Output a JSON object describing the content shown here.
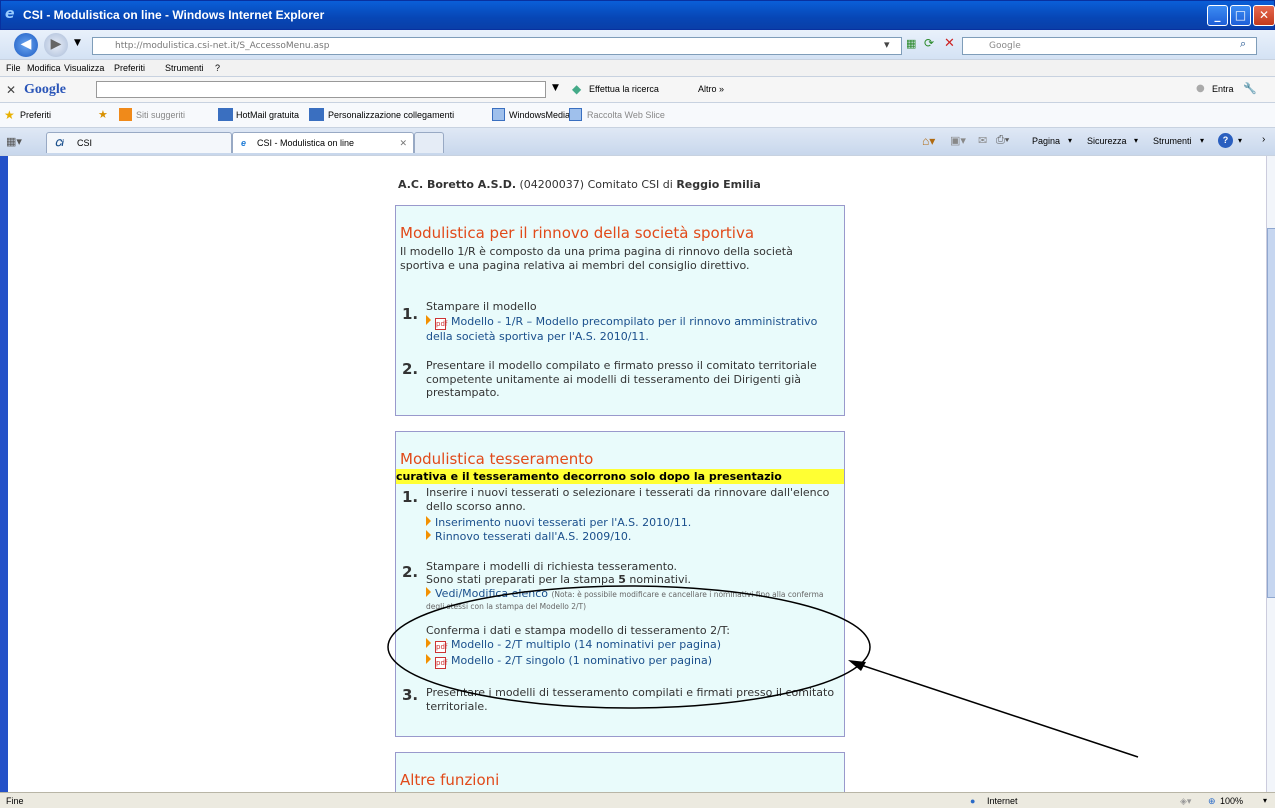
{
  "window": {
    "title": "CSI - Modulistica on line - Windows Internet Explorer"
  },
  "address": {
    "url": "http://modulistica.csi-net.it/S_AccessoMenu.asp",
    "search_placeholder": "Google"
  },
  "menu": [
    "File",
    "Modifica",
    "Visualizza",
    "Preferiti",
    "Strumenti",
    "?"
  ],
  "google_bar": {
    "brand": "Google",
    "search_label": "Effettua la ricerca",
    "more": "Altro »",
    "signin": "Entra"
  },
  "favorites": {
    "label": "Preferiti",
    "items": [
      "Siti suggeriti",
      "HotMail gratuita",
      "Personalizzazione collegamenti",
      "WindowsMedia",
      "Raccolta Web Slice"
    ]
  },
  "tabs": {
    "home": "CSI",
    "active": "CSI - Modulistica on line"
  },
  "command_bar": [
    "Pagina",
    "Sicurezza",
    "Strumenti"
  ],
  "page": {
    "org_name": "A.C. Boretto A.S.D.",
    "org_code": "(04200037)",
    "committee_prefix": "Comitato CSI di",
    "committee": "Reggio Emilia",
    "section1": {
      "title": "Modulistica per il rinnovo della società sportiva",
      "intro": "Il modello 1/R è composto da una prima pagina di rinnovo della società sportiva e una pagina relativa ai membri del consiglio direttivo.",
      "step1_num": "1.",
      "step1": "Stampare il modello",
      "step1_link": "Modello - 1/R – Modello precompilato per il rinnovo amministrativo della società sportiva per l'A.S. 2010/11.",
      "step2_num": "2.",
      "step2": "Presentare il modello compilato e firmato presso il comitato territoriale competente unitamente ai modelli di tesseramento dei Dirigenti già prestampato."
    },
    "section2": {
      "title": "Modulistica tesseramento",
      "marquee": "curativa e il tesseramento decorrono solo dopo la presentazio",
      "step1_num": "1.",
      "step1": "Inserire i nuovi tesserati o selezionare i tesserati da rinnovare dall'elenco dello scorso anno.",
      "link_new": "Inserimento nuovi tesserati per l'A.S. 2010/11.",
      "link_renew": "Rinnovo tesserati dall'A.S. 2009/10.",
      "step2_num": "2.",
      "step2a": "Stampare i modelli di richiesta tesseramento.",
      "step2b_pre": "Sono stati preparati per la stampa",
      "step2b_count": "5",
      "step2b_post": "nominativi.",
      "link_edit": "Vedi/Modifica elenco",
      "note": "(Nota: è possibile modificare e cancellare i nominativi fino alla conferma degli stessi con la stampa del Modello 2/T)",
      "confirm": "Conferma i dati e stampa modello di tesseramento 2/T:",
      "link_multi": "Modello - 2/T multiplo (14 nominativi per pagina)",
      "link_single": "Modello - 2/T singolo (1 nominativo per pagina)",
      "step3_num": "3.",
      "step3": "Presentare i modelli di tesseramento compilati e firmati presso il comitato territoriale."
    },
    "section3": {
      "title": "Altre funzioni"
    }
  },
  "status": {
    "left": "Fine",
    "zone": "Internet",
    "zoom": "100%"
  }
}
